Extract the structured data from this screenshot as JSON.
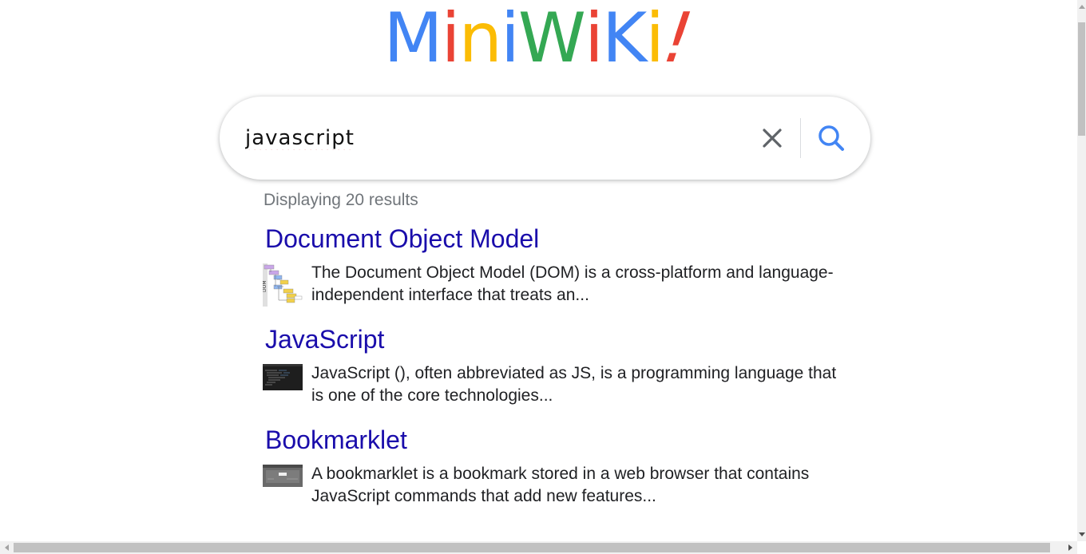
{
  "logo": {
    "letters": [
      {
        "char": "M",
        "color": "#4285f4"
      },
      {
        "char": "i",
        "color": "#ea4335"
      },
      {
        "char": "n",
        "color": "#fbbc05"
      },
      {
        "char": "i",
        "color": "#4285f4"
      },
      {
        "char": "W",
        "color": "#34a853"
      },
      {
        "char": "i",
        "color": "#ea4335"
      },
      {
        "char": "K",
        "color": "#4285f4"
      },
      {
        "char": "i",
        "color": "#fbbc05"
      },
      {
        "char": "!",
        "color": "#ea4335"
      }
    ]
  },
  "search": {
    "value": "javascript",
    "clear_icon": "close-icon",
    "search_icon": "search-icon",
    "accent": "#4285f4"
  },
  "results": {
    "count_text": "Displaying 20 results",
    "items": [
      {
        "title": "Document Object Model",
        "snippet": "The Document Object Model (DOM) is a cross-platform and language-independent interface that treats an..."
      },
      {
        "title": "JavaScript",
        "snippet": "JavaScript (), often abbreviated as JS, is a programming language that is one of the core technologies..."
      },
      {
        "title": "Bookmarklet",
        "snippet": "A bookmarklet is a bookmark stored in a web browser that contains JavaScript commands that add new features..."
      }
    ],
    "link_color": "#1a0dab"
  }
}
